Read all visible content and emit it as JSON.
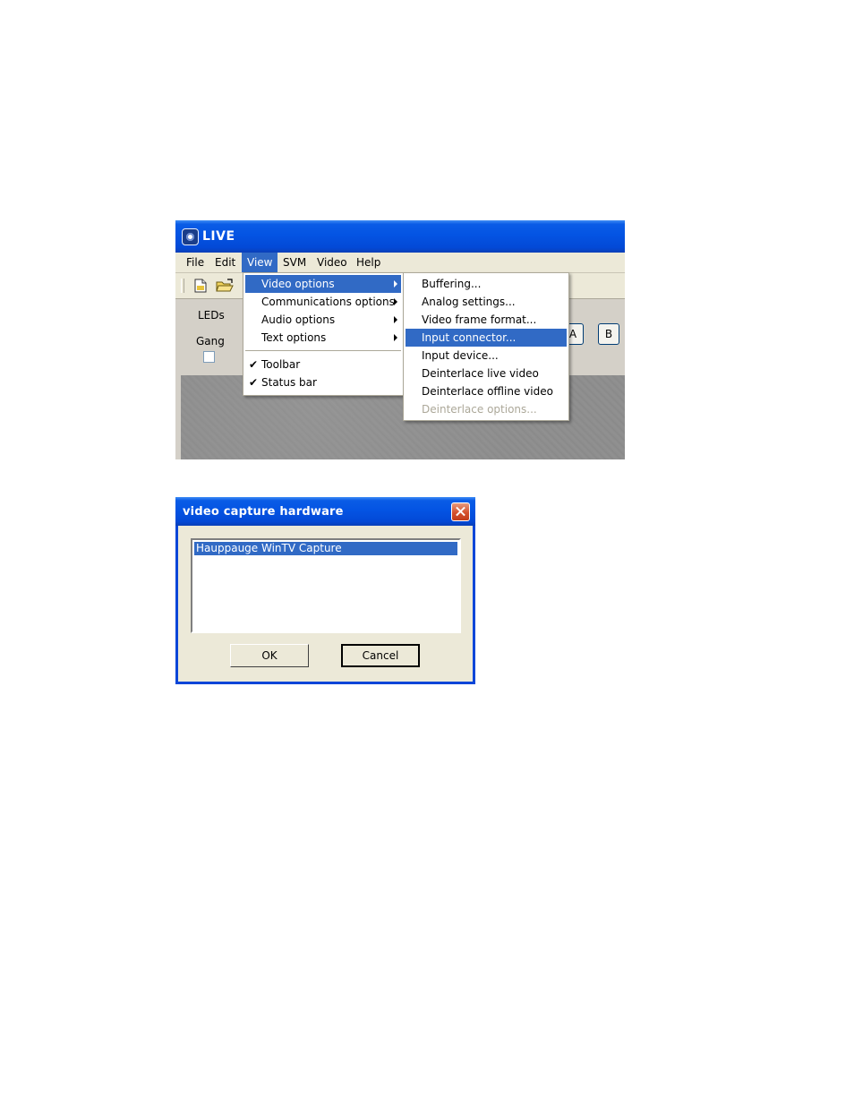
{
  "main_window": {
    "title": "LIVE",
    "menubar": [
      "File",
      "Edit",
      "View",
      "SVM",
      "Video",
      "Help"
    ],
    "panel": {
      "leds_label": "LEDs",
      "gang_label": "Gang",
      "button_a": "A",
      "button_b": "B"
    }
  },
  "view_menu": {
    "items": [
      {
        "label": "Video options",
        "submenu": true,
        "highlighted": true
      },
      {
        "label": "Communications options",
        "submenu": true
      },
      {
        "label": "Audio options",
        "submenu": true
      },
      {
        "label": "Text options",
        "submenu": true
      },
      {
        "label": "Toolbar",
        "checked": true
      },
      {
        "label": "Status bar",
        "checked": true
      }
    ]
  },
  "video_options_submenu": {
    "items": [
      {
        "label": "Buffering..."
      },
      {
        "label": "Analog settings..."
      },
      {
        "label": "Video frame format..."
      },
      {
        "label": "Input connector...",
        "highlighted": true
      },
      {
        "label": "Input device..."
      },
      {
        "label": "Deinterlace live video"
      },
      {
        "label": "Deinterlace offline video"
      },
      {
        "label": "Deinterlace options...",
        "disabled": true
      }
    ]
  },
  "dialog": {
    "title": "video capture hardware",
    "list_items": [
      "Hauppauge WinTV Capture"
    ],
    "ok_label": "OK",
    "cancel_label": "Cancel"
  },
  "colors": {
    "xp_title_blue": "#0454e3",
    "highlight": "#316ac5",
    "menu_bg": "#ece9d8",
    "close_red": "#d4502c"
  }
}
